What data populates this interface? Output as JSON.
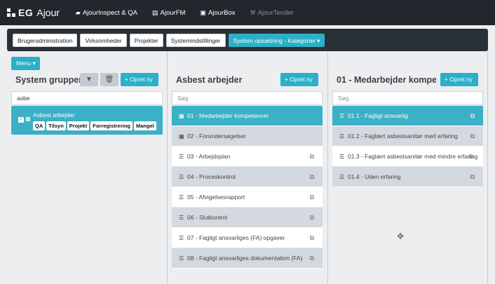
{
  "brand": {
    "eg": "EG",
    "ajour": "Ajour"
  },
  "topnav": [
    {
      "label": "AjourInspect & QA",
      "icon": "car-icon",
      "glyph": "▰"
    },
    {
      "label": "AjourFM",
      "icon": "building-icon",
      "glyph": "▤"
    },
    {
      "label": "AjourBox",
      "icon": "box-icon",
      "glyph": "▣"
    },
    {
      "label": "AjourTender",
      "icon": "gavel-icon",
      "glyph": "⚒"
    }
  ],
  "subnav": [
    "Brugeradministration",
    "Virksomheder",
    "Projekter",
    "Systemindstillinger",
    "System opsætning - Kategorier ▾"
  ],
  "menu_label": "Menu ▾",
  "col1": {
    "title": "System grupper",
    "create": "+ Opret ny",
    "search_value": "asbe",
    "group": {
      "name": "Asbest arbejder",
      "tags": [
        "QA",
        "Tilsyn",
        "Projekt",
        "Forregistrering",
        "Mangel"
      ]
    }
  },
  "col2": {
    "title": "Asbest arbejder",
    "create": "+ Opret ny",
    "search_placeholder": "Søg",
    "rows": [
      "01 - Medarbejder kompetencer",
      "02 - Forundersøgelser",
      "03 - Arbejdsplan",
      "04 - Proceskontrol",
      "05 - Afvigelsesrapport",
      "06 - Slutkontrol",
      "07 - Fagligt ansvarliges (FA) opgaver",
      "08 - Fagligt ansvarliges dokumentation (FA)"
    ]
  },
  "col3": {
    "title": "01 - Medarbejder kompete…",
    "create": "+ Opret ny",
    "search_placeholder": "Søg",
    "rows": [
      "01.1 - Fagligt ansvarlig",
      "01.2 - Faglært asbestsanitør med erfaring",
      "01.3 - Faglært asbestsanitør med mindre erfaring",
      "01.4 - Uden erfaring"
    ]
  },
  "colors": {
    "accent": "#2ab0c9",
    "navbar": "#22272e"
  }
}
